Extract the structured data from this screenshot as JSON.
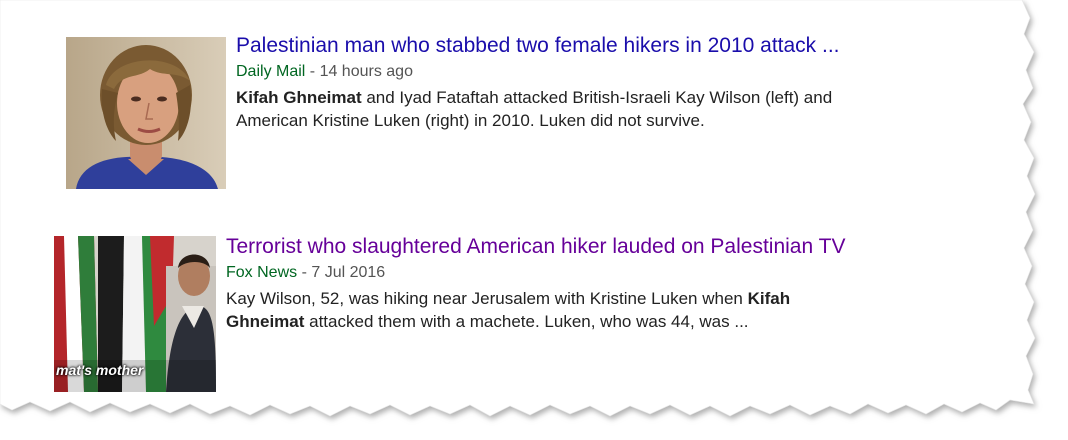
{
  "colors": {
    "link_unvisited": "#1a0dab",
    "link_visited": "#660099",
    "source_green": "#006621",
    "meta_grey": "#545454",
    "snippet_text": "#222222",
    "paper_edge_shadow": "#999999"
  },
  "results": [
    {
      "title": "Palestinian man who stabbed two female hikers in 2010 attack ...",
      "source": "Daily Mail",
      "separator": " - ",
      "age": "14 hours ago",
      "snippet_parts": [
        {
          "text": "Kifah Ghneimat",
          "bold": true
        },
        {
          "text": " and Iyad Fataftah attacked British-Israeli Kay Wilson (left) and",
          "bold": false
        },
        {
          "text": "American Kristine Luken (right) in 2010. Luken did not survive.",
          "bold": false
        }
      ],
      "thumbnail_icon": "woman-portrait-photo"
    },
    {
      "title": "Terrorist who slaughtered American hiker lauded on Palestinian TV",
      "source": "Fox News",
      "separator": " - ",
      "age": "7 Jul 2016",
      "snippet_parts": [
        {
          "text": "Kay Wilson, 52, was hiking near Jerusalem with Kristine Luken when ",
          "bold": false
        },
        {
          "text": "Kifah",
          "bold": true
        },
        {
          "text": "Ghneimat",
          "bold": true
        },
        {
          "text": " attacked them with a machete. Luken, who was 44, was ...",
          "bold": false
        }
      ],
      "thumbnail_caption": "mat's mother",
      "thumbnail_icon": "flags-and-man-photo"
    }
  ]
}
